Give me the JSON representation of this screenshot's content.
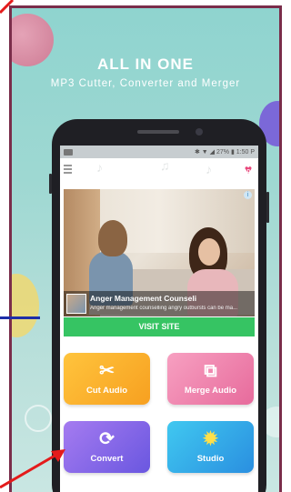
{
  "headline": {
    "title": "ALL IN ONE",
    "subtitle": "MP3 Cutter, Converter and Merger"
  },
  "status_bar": {
    "battery": "27%",
    "time": "1:50 P"
  },
  "ad": {
    "title": "Anger Management Counseli",
    "text": "Anger management counselling angry outbursts can be ma...",
    "cta": "VISIT SITE",
    "badge": "AD"
  },
  "tiles": [
    {
      "label": "Cut Audio",
      "icon": "scissors-icon"
    },
    {
      "label": "Merge Audio",
      "icon": "merge-icon"
    },
    {
      "label": "Convert",
      "icon": "refresh-icon"
    },
    {
      "label": "Studio",
      "icon": "sparkle-icon"
    }
  ],
  "colors": {
    "frame": "#7a2d4a",
    "background": "#9ed8d2",
    "arrow": "#e41b1b",
    "cut": "#f7a020",
    "merge": "#e76b9c",
    "convert": "#6a57e0",
    "studio": "#2a8fe0",
    "visit": "#36c463"
  }
}
